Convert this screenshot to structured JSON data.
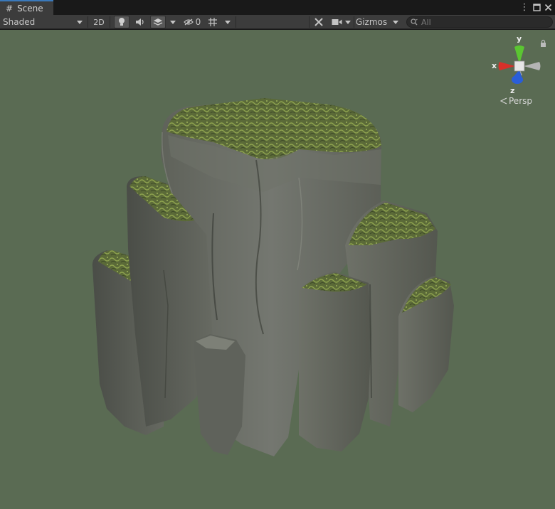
{
  "window": {
    "tab_label": "Scene",
    "tab_icon": "grid-hash-icon"
  },
  "toolbar": {
    "shading_mode": "Shaded",
    "toggle_2d": "2D",
    "hidden_count": "0",
    "gizmos_label": "Gizmos",
    "search_placeholder": "All"
  },
  "viewport": {
    "background_color": "#5a6b53",
    "projection_label": "Persp",
    "axes": {
      "x": "x",
      "y": "y",
      "z": "z"
    },
    "axis_colors": {
      "x": "#d7302a",
      "y": "#5bc532",
      "z": "#2a5ed8"
    },
    "object": "stylized rock pillar cluster with mossy tops"
  }
}
